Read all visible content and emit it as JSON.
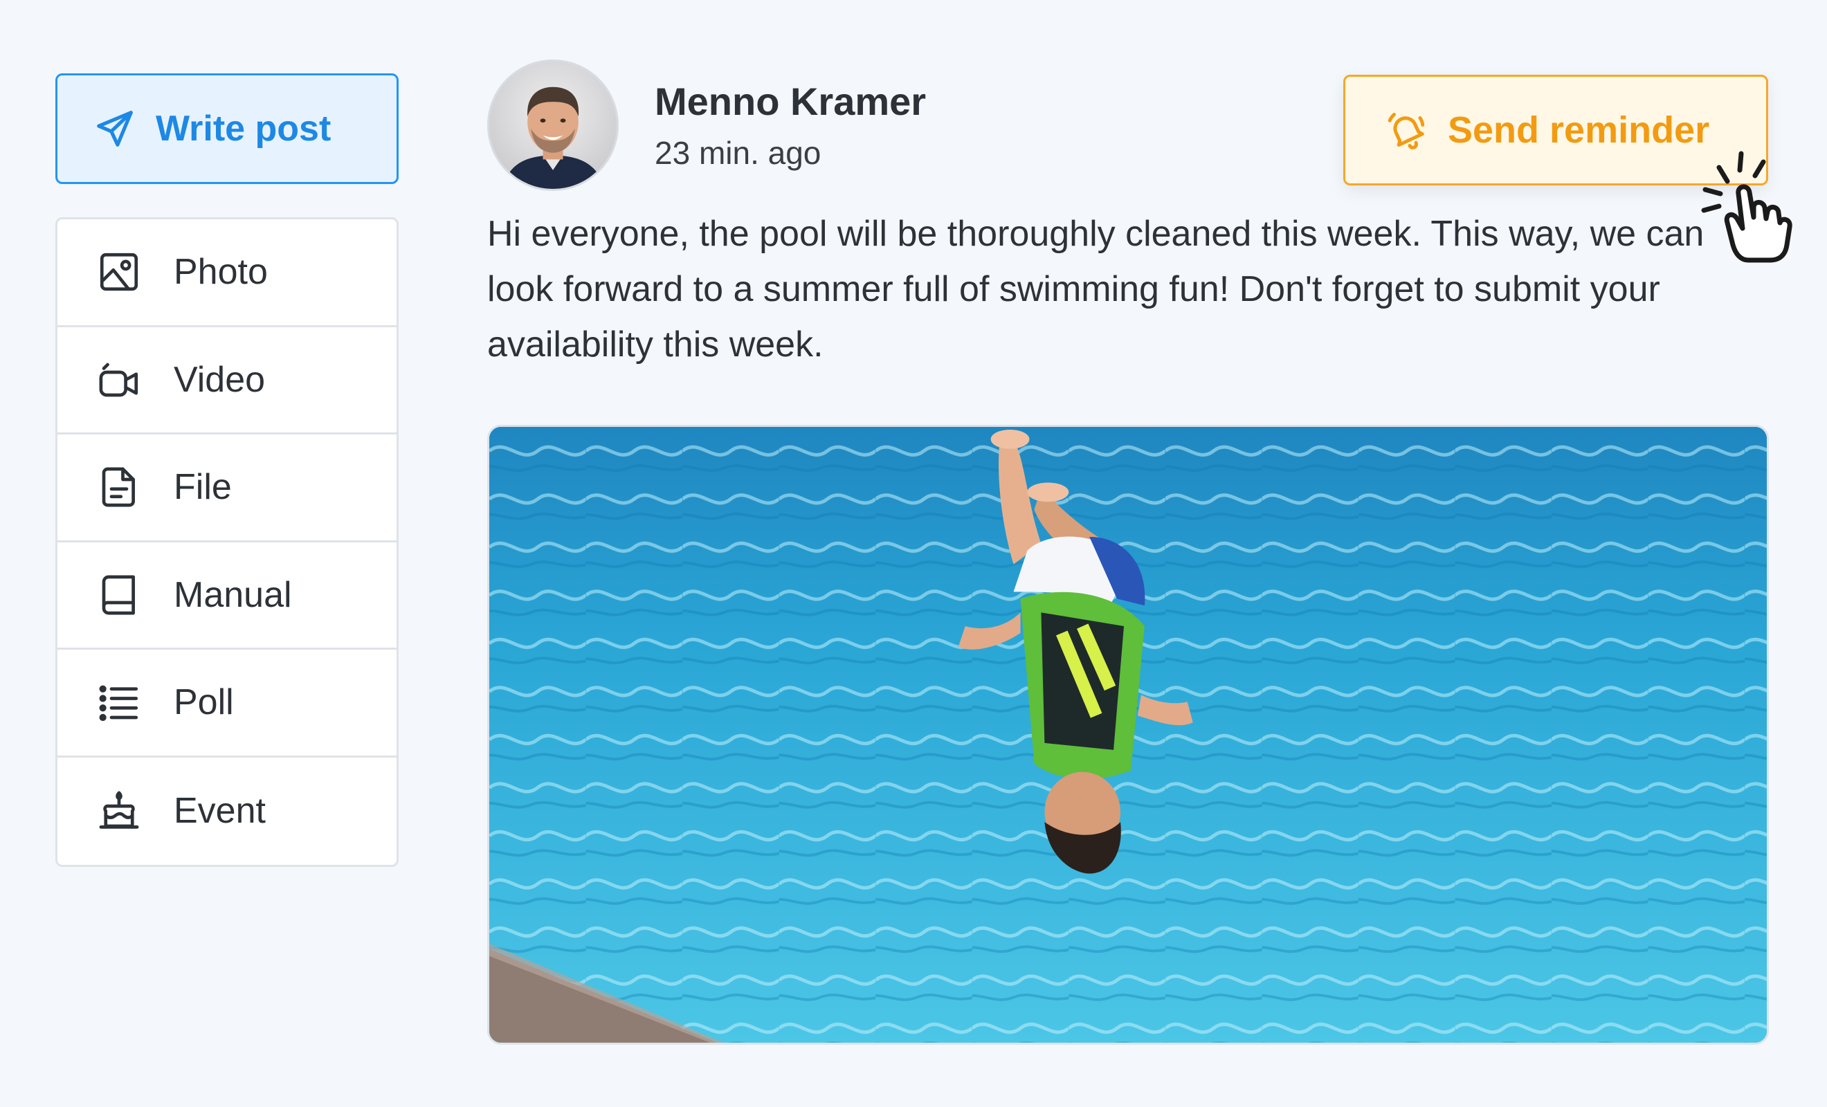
{
  "sidebar": {
    "write_post": {
      "label": "Write post",
      "icon": "send-icon"
    },
    "items": [
      {
        "label": "Photo",
        "icon": "photo-icon"
      },
      {
        "label": "Video",
        "icon": "video-icon"
      },
      {
        "label": "File",
        "icon": "file-icon"
      },
      {
        "label": "Manual",
        "icon": "book-icon"
      },
      {
        "label": "Poll",
        "icon": "list-icon"
      },
      {
        "label": "Event",
        "icon": "cake-icon"
      }
    ]
  },
  "post": {
    "author": "Menno Kramer",
    "time": "23 min. ago",
    "text": "Hi everyone, the pool will be thoroughly cleaned this week. This way, we can look forward to a summer full of swimming fun! Don't forget to submit your availability this week.",
    "reminder_label": "Send reminder",
    "reminder_icon": "bell-ringing-icon"
  },
  "colors": {
    "primary": "#2196f3",
    "primary_bg": "#e6f3fe",
    "accent": "#f29b12",
    "accent_bg": "#fff8e6",
    "page_bg": "#f4f7fb"
  }
}
